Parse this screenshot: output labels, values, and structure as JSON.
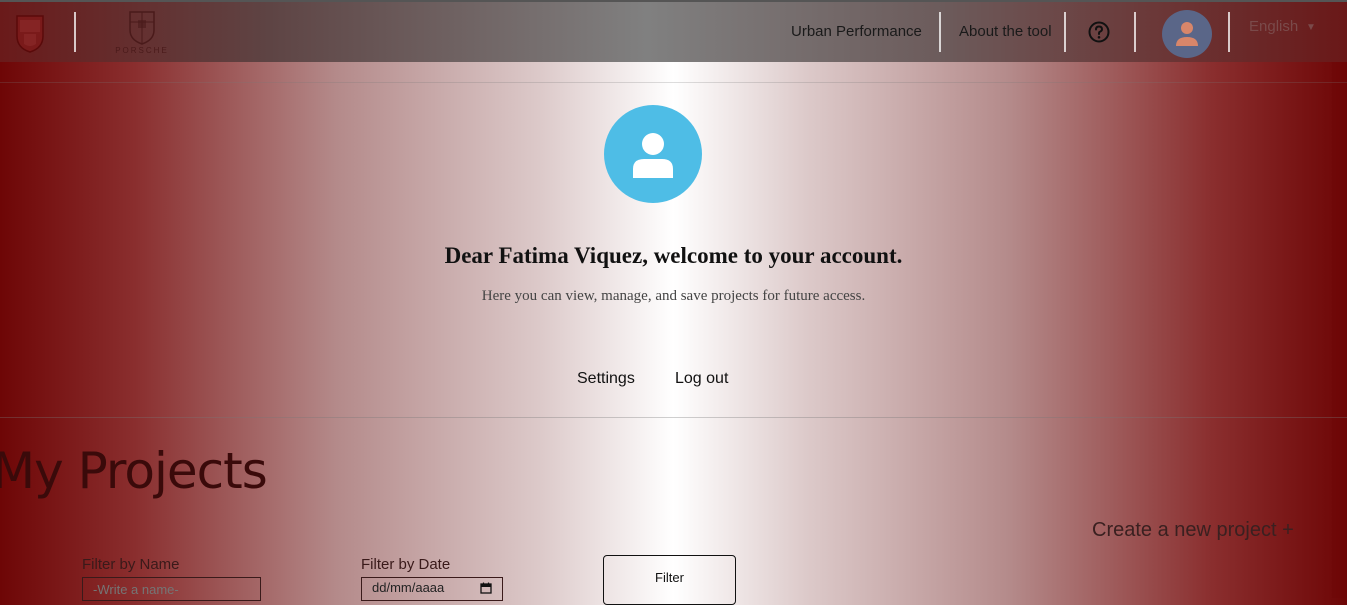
{
  "header": {
    "brand_name": "PORSCHE",
    "nav": [
      "Urban Performance",
      "About the tool"
    ],
    "help_icon": "question-circle-icon",
    "avatar_icon": "user-icon",
    "language": "English"
  },
  "welcome": {
    "avatar_icon": "user-icon",
    "title": "Dear Fatima Viquez, welcome to your account.",
    "subtitle": "Here you can view, manage, and save projects for future access.",
    "links": [
      "Settings",
      "Log out"
    ]
  },
  "projects": {
    "title": "My Projects",
    "create_label": "Create a new project +",
    "filter_name_label": "Filter by Name",
    "filter_name_placeholder": "-Write a name-",
    "filter_date_label": "Filter by Date",
    "filter_date_value": "dd/mm/aaaa",
    "filter_button": "Filter"
  },
  "colors": {
    "accent_red": "#6e0606",
    "avatar_blue": "#4ebde6"
  }
}
